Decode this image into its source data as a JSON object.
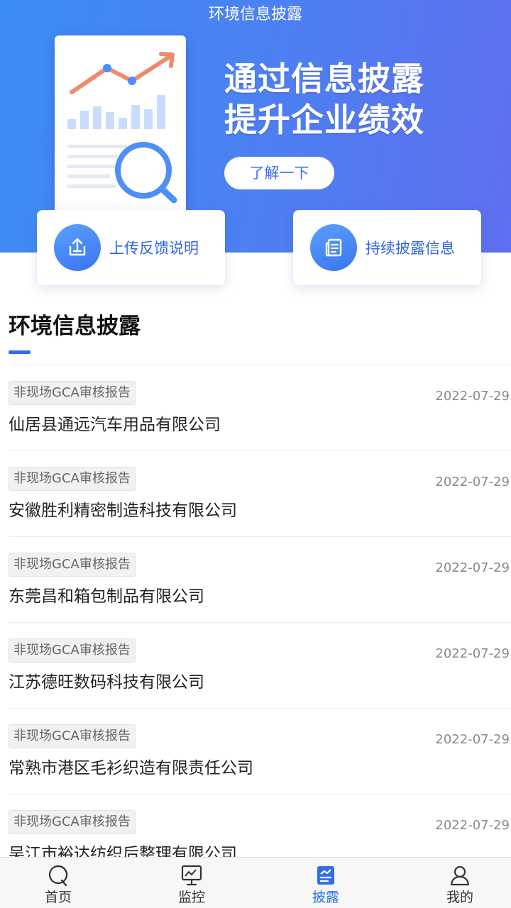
{
  "header": {
    "title": "环境信息披露"
  },
  "banner": {
    "headline_line1": "通过信息披露",
    "headline_line2": "提升企业绩效",
    "button_label": "了解一下"
  },
  "quick_actions": [
    {
      "label": "上传反馈说明",
      "icon": "upload-icon"
    },
    {
      "label": "持续披露信息",
      "icon": "document-list-icon"
    }
  ],
  "section": {
    "title": "环境信息披露"
  },
  "disclosures": [
    {
      "tag": "非现场GCA审核报告",
      "date": "2022-07-29",
      "company": "仙居县通远汽车用品有限公司"
    },
    {
      "tag": "非现场GCA审核报告",
      "date": "2022-07-29",
      "company": "安徽胜利精密制造科技有限公司"
    },
    {
      "tag": "非现场GCA审核报告",
      "date": "2022-07-29",
      "company": "东莞昌和箱包制品有限公司"
    },
    {
      "tag": "非现场GCA审核报告",
      "date": "2022-07-29",
      "company": "江苏德旺数码科技有限公司"
    },
    {
      "tag": "非现场GCA审核报告",
      "date": "2022-07-29",
      "company": "常熟市港区毛衫织造有限责任公司"
    },
    {
      "tag": "非现场GCA审核报告",
      "date": "2022-07-29",
      "company": "吴江市裕达纺织后整理有限公司"
    }
  ],
  "tabs": [
    {
      "label": "首页",
      "icon": "home-icon",
      "active": false
    },
    {
      "label": "监控",
      "icon": "monitor-icon",
      "active": false
    },
    {
      "label": "披露",
      "icon": "disclosure-icon",
      "active": true
    },
    {
      "label": "我的",
      "icon": "user-icon",
      "active": false
    }
  ],
  "colors": {
    "accent": "#2f6fe6",
    "banner_start": "#3d8cf5",
    "banner_end": "#5f6ff0"
  }
}
